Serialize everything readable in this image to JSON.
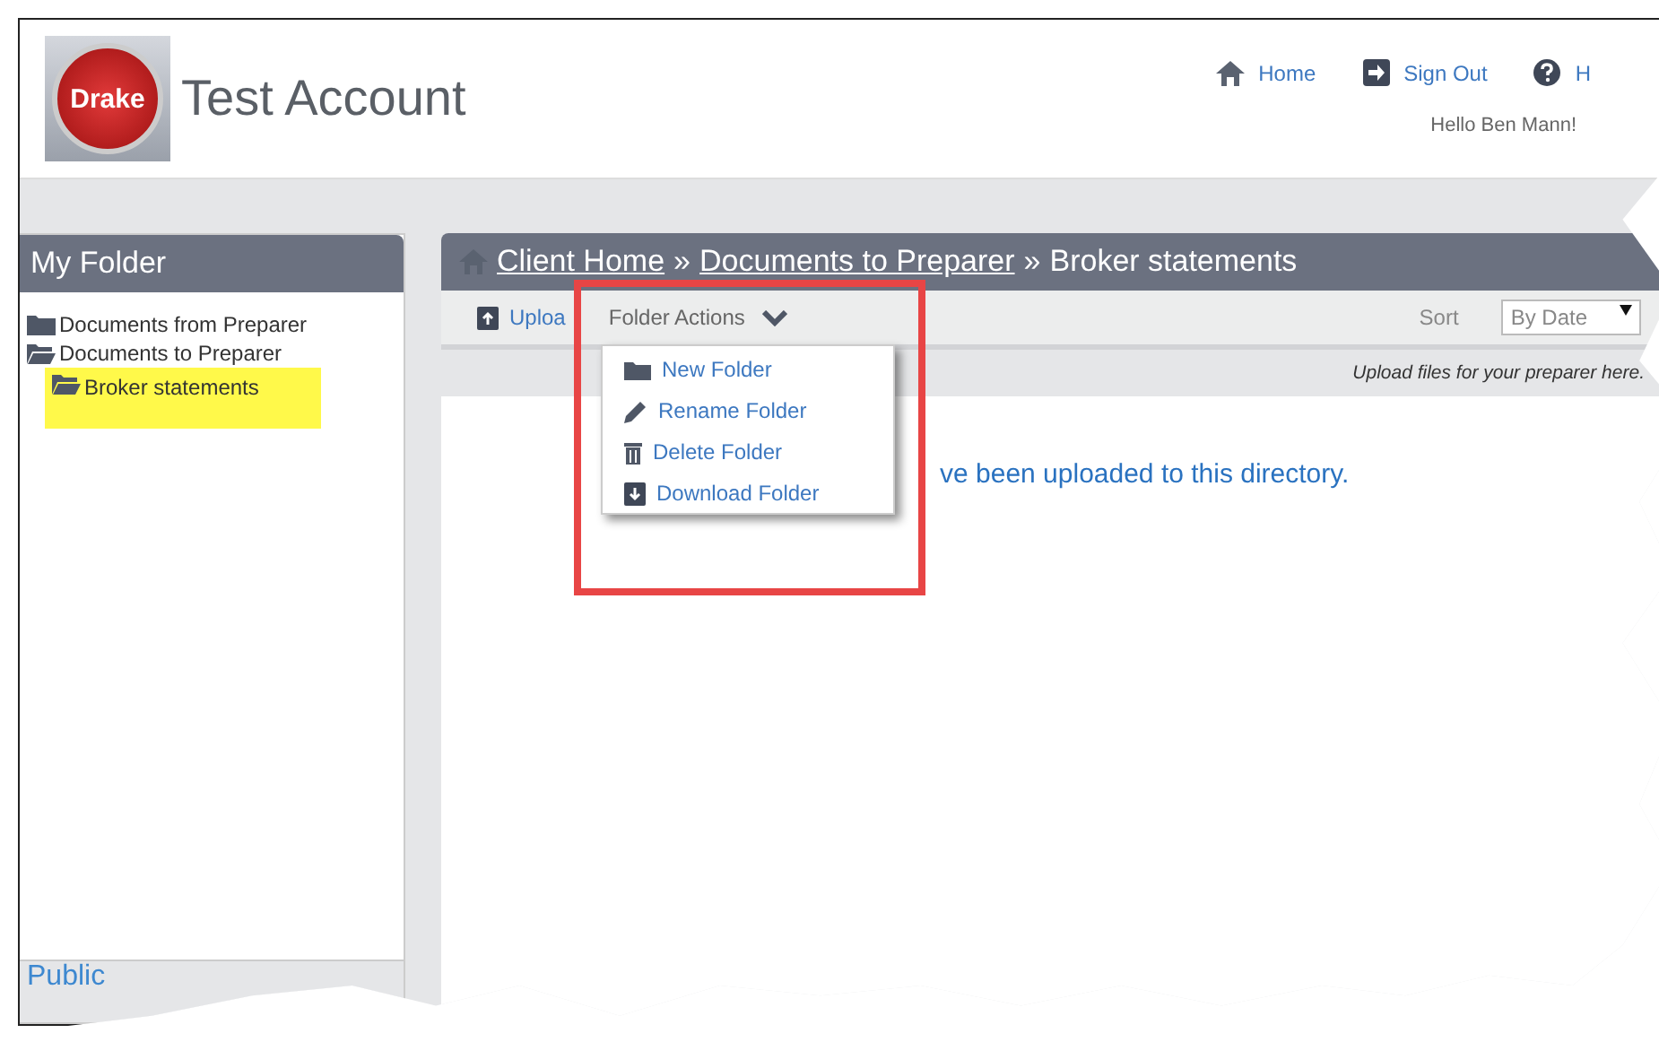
{
  "header": {
    "logo_text": "Drake",
    "title": "Test Account",
    "nav": [
      {
        "label": "Home",
        "kind": "home"
      },
      {
        "label": "Sign Out",
        "kind": "signout"
      },
      {
        "label": "H",
        "kind": "help"
      }
    ],
    "greeting": "Hello Ben Mann!"
  },
  "sidebar": {
    "title": "My Folder",
    "tree": [
      {
        "label": "Documents from Preparer",
        "expanded": false,
        "selected": false
      },
      {
        "label": "Documents to Preparer",
        "expanded": true,
        "selected": false,
        "children": [
          {
            "label": "Broker statements",
            "expanded": true,
            "selected": true
          }
        ]
      }
    ],
    "footer_link": "Public"
  },
  "main": {
    "breadcrumb": [
      {
        "kind": "link",
        "text": "Client Home"
      },
      {
        "kind": "sep",
        "text": "»"
      },
      {
        "kind": "link",
        "text": "Documents to Preparer"
      },
      {
        "kind": "sep",
        "text": "»"
      },
      {
        "kind": "current",
        "text": "Broker statements"
      }
    ],
    "toolbar": {
      "upload": "Uploa",
      "folder_actions": "Folder Actions",
      "sort_label": "Sort",
      "sort_value": "By Date"
    },
    "hint": "Upload files for your preparer here.",
    "empty_message": "ve been uploaded to this directory.",
    "menu": [
      {
        "label": "New Folder",
        "kind": "folder"
      },
      {
        "label": "Rename Folder",
        "kind": "pencil"
      },
      {
        "label": "Delete Folder",
        "kind": "trash"
      },
      {
        "label": "Download Folder",
        "kind": "download"
      }
    ]
  }
}
